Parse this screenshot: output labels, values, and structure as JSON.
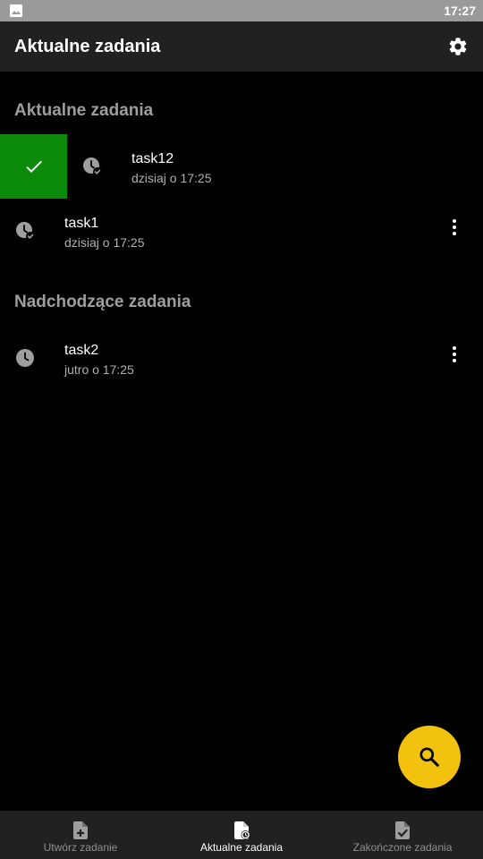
{
  "status_bar": {
    "time": "17:27"
  },
  "app_bar": {
    "title": "Aktualne zadania"
  },
  "sections": {
    "current": {
      "header": "Aktualne zadania"
    },
    "upcoming": {
      "header": "Nadchodzące zadania"
    }
  },
  "tasks": [
    {
      "title": "task12",
      "subtitle": "dzisiaj o 17:25",
      "swiped": true
    },
    {
      "title": "task1",
      "subtitle": "dzisiaj o 17:25"
    },
    {
      "title": "task2",
      "subtitle": "jutro o 17:25"
    }
  ],
  "bottom_nav": {
    "items": [
      {
        "label": "Utwórz zadanie"
      },
      {
        "label": "Aktualne zadania",
        "active": true
      },
      {
        "label": "Zakończone zadania"
      }
    ]
  },
  "colors": {
    "accent_fab": "#f2c20f",
    "swipe_done": "#0b8a0b",
    "app_bar": "#212121",
    "section_header": "#9e9e9e"
  }
}
